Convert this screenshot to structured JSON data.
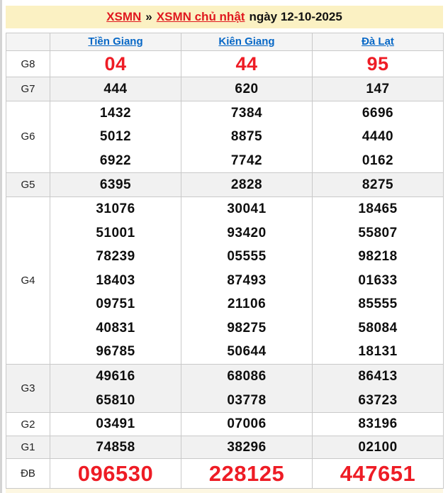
{
  "title": {
    "link1": "XSMN",
    "separator": "»",
    "link2": "XSMN chủ nhật",
    "date_text": "ngày 12-10-2025"
  },
  "colors": {
    "accent_red": "#ee1c25",
    "link_blue": "#0667c6",
    "title_bg": "#fbf1c3",
    "row_alt_bg": "#f1f1f1",
    "border": "#c9c9c9"
  },
  "results_table": {
    "columns": [
      "Tiền Giang",
      "Kiên Giang",
      "Đà Lạt"
    ],
    "rows": [
      {
        "label": "G8",
        "style": "red-large",
        "values": [
          [
            "04"
          ],
          [
            "44"
          ],
          [
            "95"
          ]
        ]
      },
      {
        "label": "G7",
        "values": [
          [
            "444"
          ],
          [
            "620"
          ],
          [
            "147"
          ]
        ]
      },
      {
        "label": "G6",
        "values": [
          [
            "1432",
            "5012",
            "6922"
          ],
          [
            "7384",
            "8875",
            "7742"
          ],
          [
            "6696",
            "4440",
            "0162"
          ]
        ]
      },
      {
        "label": "G5",
        "values": [
          [
            "6395"
          ],
          [
            "2828"
          ],
          [
            "8275"
          ]
        ]
      },
      {
        "label": "G4",
        "values": [
          [
            "31076",
            "51001",
            "78239",
            "18403",
            "09751",
            "40831",
            "96785"
          ],
          [
            "30041",
            "93420",
            "05555",
            "87493",
            "21106",
            "98275",
            "50644"
          ],
          [
            "18465",
            "55807",
            "98218",
            "01633",
            "85555",
            "58084",
            "18131"
          ]
        ]
      },
      {
        "label": "G3",
        "values": [
          [
            "49616",
            "65810"
          ],
          [
            "68086",
            "03778"
          ],
          [
            "86413",
            "63723"
          ]
        ]
      },
      {
        "label": "G2",
        "values": [
          [
            "03491"
          ],
          [
            "07006"
          ],
          [
            "83196"
          ]
        ]
      },
      {
        "label": "G1",
        "values": [
          [
            "74858"
          ],
          [
            "38296"
          ],
          [
            "02100"
          ]
        ]
      },
      {
        "label": "ĐB",
        "style": "red-xlarge",
        "values": [
          [
            "096530"
          ],
          [
            "228125"
          ],
          [
            "447651"
          ]
        ]
      }
    ]
  }
}
